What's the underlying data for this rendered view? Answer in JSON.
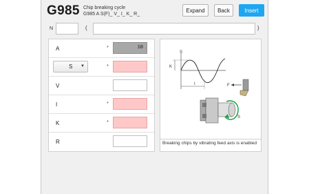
{
  "header": {
    "code": "G985",
    "title": "Chip breaking cycle",
    "syntax": "G985 A S(F)_ V_ I_ K_ R_",
    "expand_label": "Expand",
    "back_label": "Back",
    "insert_label": "Insert",
    "accent": "#1ea7f0"
  },
  "nrow": {
    "n_label": "N",
    "n_value": "",
    "paren_open": "(",
    "comment_value": "",
    "paren_close": ")"
  },
  "params": [
    {
      "label": "A",
      "required": "*",
      "value": "10",
      "state": "disabled"
    },
    {
      "select": "S",
      "required": "*",
      "value": "",
      "state": "error"
    },
    {
      "label": "V",
      "required": "",
      "value": "",
      "state": "normal"
    },
    {
      "label": "I",
      "required": "*",
      "value": "",
      "state": "error"
    },
    {
      "label": "K",
      "required": "*",
      "value": "",
      "state": "error"
    },
    {
      "label": "R",
      "required": "",
      "value": "",
      "state": "normal"
    }
  ],
  "graphic": {
    "labels": {
      "s_top": "S",
      "k": "K",
      "i": "I",
      "f": "F",
      "s_spindle": "S"
    },
    "caption": "Breaking chips by vibrating feed axis is enabled",
    "error_color": "#ffc8c8"
  }
}
